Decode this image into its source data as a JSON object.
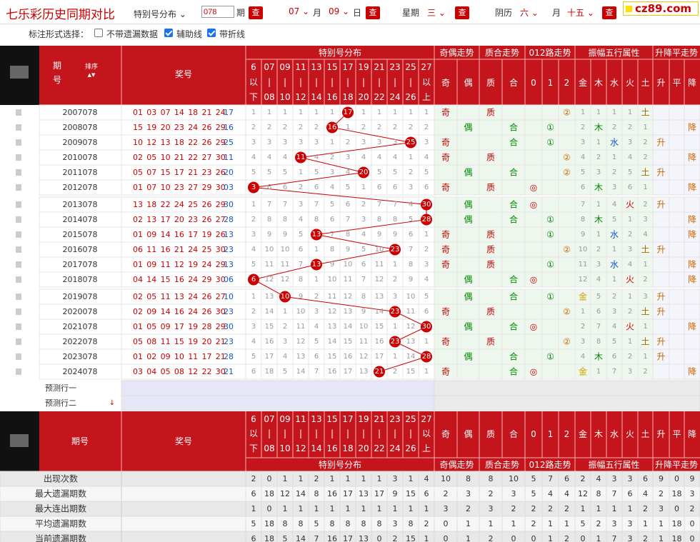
{
  "header": {
    "title": "七乐彩历史同期对比",
    "dist_select": "特别号分布",
    "period_input": "078",
    "period_label": "期",
    "query_label": "查",
    "month_value": "07",
    "month_label": "月",
    "day_value": "09",
    "day_label": "日",
    "weekday_label": "星期",
    "weekday_value": "三",
    "lunar_label": "阴历",
    "lunar_month_value": "六",
    "lunar_month_label": "月",
    "lunar_day_value": "十五",
    "logo": "cz89.com"
  },
  "options": {
    "label": "标注形式选择：",
    "opt1": "不带遗漏数据",
    "opt2": "辅助线",
    "opt3": "带折线",
    "opt1_checked": false,
    "opt2_checked": true,
    "opt3_checked": true
  },
  "table": {
    "head": {
      "period": "期号",
      "sort": "排序",
      "numbers": "奖号",
      "dist_group": "特别号分布",
      "parity_group": "奇偶走势",
      "prime_group": "质合走势",
      "r012_group": "012路走势",
      "wuxing_group": "振幅五行属性",
      "trend_group": "升降平走势",
      "dist_cols": [
        [
          "6",
          "以",
          "下"
        ],
        [
          "07",
          "|",
          "08"
        ],
        [
          "09",
          "|",
          "10"
        ],
        [
          "11",
          "|",
          "12"
        ],
        [
          "13",
          "|",
          "14"
        ],
        [
          "15",
          "|",
          "16"
        ],
        [
          "17",
          "|",
          "18"
        ],
        [
          "19",
          "|",
          "20"
        ],
        [
          "21",
          "|",
          "22"
        ],
        [
          "23",
          "|",
          "24"
        ],
        [
          "25",
          "|",
          "26"
        ],
        [
          "27",
          "以",
          "上"
        ]
      ],
      "sub_cols": [
        "奇",
        "偶",
        "质",
        "合",
        "0",
        "1",
        "2",
        "金",
        "木",
        "水",
        "火",
        "土",
        "升",
        "平",
        "降"
      ]
    },
    "rows": [
      {
        "period": "2007078",
        "nums": [
          "01",
          "03",
          "07",
          "14",
          "18",
          "21",
          "24"
        ],
        "special": "17",
        "dist": [
          "1",
          "1",
          "1",
          "1",
          "1",
          "1",
          "17",
          "1",
          "1",
          "1",
          "1",
          "1"
        ],
        "hit": 6,
        "sub": [
          "奇",
          "",
          "质",
          "",
          "",
          "",
          "②",
          "1",
          "1",
          "1",
          "1",
          "土",
          "",
          "",
          ""
        ]
      },
      {
        "period": "2008078",
        "nums": [
          "15",
          "19",
          "20",
          "23",
          "24",
          "26",
          "29"
        ],
        "special": "16",
        "dist": [
          "2",
          "2",
          "2",
          "2",
          "2",
          "16",
          "1",
          "2",
          "2",
          "2",
          "2",
          "2"
        ],
        "hit": 5,
        "sub": [
          "",
          "偶",
          "",
          "合",
          "",
          "①",
          "",
          "2",
          "木",
          "2",
          "2",
          "1",
          "",
          "",
          "降"
        ]
      },
      {
        "period": "2009078",
        "nums": [
          "10",
          "12",
          "13",
          "18",
          "22",
          "26",
          "29"
        ],
        "special": "25",
        "dist": [
          "3",
          "3",
          "3",
          "3",
          "3",
          "1",
          "2",
          "3",
          "3",
          "3",
          "25",
          "3"
        ],
        "hit": 10,
        "sub": [
          "奇",
          "",
          "",
          "合",
          "",
          "①",
          "",
          "3",
          "1",
          "水",
          "3",
          "2",
          "升",
          "",
          ""
        ]
      },
      {
        "period": "2010078",
        "nums": [
          "02",
          "05",
          "10",
          "21",
          "22",
          "27",
          "30"
        ],
        "special": "11",
        "dist": [
          "4",
          "4",
          "4",
          "11",
          "4",
          "2",
          "3",
          "4",
          "4",
          "4",
          "1",
          "4"
        ],
        "hit": 3,
        "sub": [
          "奇",
          "",
          "质",
          "",
          "",
          "",
          "②",
          "4",
          "2",
          "1",
          "4",
          "2",
          "",
          "",
          "降"
        ]
      },
      {
        "period": "2011078",
        "nums": [
          "05",
          "07",
          "15",
          "17",
          "21",
          "23",
          "26"
        ],
        "special": "20",
        "dist": [
          "5",
          "5",
          "5",
          "1",
          "5",
          "3",
          "4",
          "20",
          "5",
          "5",
          "2",
          "5"
        ],
        "hit": 7,
        "sub": [
          "",
          "偶",
          "",
          "合",
          "",
          "",
          "②",
          "5",
          "3",
          "2",
          "5",
          "土",
          "升",
          "",
          ""
        ]
      },
      {
        "period": "2012078",
        "nums": [
          "01",
          "07",
          "10",
          "23",
          "27",
          "29",
          "30"
        ],
        "special": "03",
        "dist": [
          "3",
          "6",
          "6",
          "2",
          "6",
          "4",
          "5",
          "1",
          "6",
          "6",
          "3",
          "6"
        ],
        "hit": 0,
        "sub": [
          "奇",
          "",
          "质",
          "",
          "◎",
          "",
          "",
          "6",
          "木",
          "3",
          "6",
          "1",
          "",
          "",
          "降"
        ]
      },
      {
        "period": "2013078",
        "nums": [
          "13",
          "18",
          "22",
          "24",
          "25",
          "26",
          "29"
        ],
        "special": "30",
        "dist": [
          "1",
          "7",
          "7",
          "3",
          "7",
          "5",
          "6",
          "2",
          "7",
          "7",
          "4",
          "30"
        ],
        "hit": 11,
        "sub": [
          "",
          "偶",
          "",
          "合",
          "◎",
          "",
          "",
          "7",
          "1",
          "4",
          "火",
          "2",
          "升",
          "",
          ""
        ]
      },
      {
        "period": "2014078",
        "nums": [
          "02",
          "13",
          "17",
          "20",
          "23",
          "26",
          "27"
        ],
        "special": "28",
        "dist": [
          "2",
          "8",
          "8",
          "4",
          "8",
          "6",
          "7",
          "3",
          "8",
          "8",
          "5",
          "28"
        ],
        "hit": 11,
        "sub": [
          "",
          "偶",
          "",
          "合",
          "",
          "①",
          "",
          "8",
          "木",
          "5",
          "1",
          "3",
          "",
          "",
          "降"
        ]
      },
      {
        "period": "2015078",
        "nums": [
          "01",
          "09",
          "14",
          "16",
          "17",
          "19",
          "26"
        ],
        "special": "13",
        "dist": [
          "3",
          "9",
          "9",
          "5",
          "13",
          "7",
          "8",
          "4",
          "9",
          "9",
          "6",
          "1"
        ],
        "hit": 4,
        "sub": [
          "奇",
          "",
          "质",
          "",
          "",
          "①",
          "",
          "9",
          "1",
          "水",
          "2",
          "4",
          "",
          "",
          "降"
        ]
      },
      {
        "period": "2016078",
        "nums": [
          "06",
          "11",
          "16",
          "21",
          "24",
          "25",
          "30"
        ],
        "special": "23",
        "dist": [
          "4",
          "10",
          "10",
          "6",
          "1",
          "8",
          "9",
          "5",
          "10",
          "23",
          "7",
          "2"
        ],
        "hit": 9,
        "sub": [
          "奇",
          "",
          "质",
          "",
          "",
          "",
          "②",
          "10",
          "2",
          "1",
          "3",
          "土",
          "升",
          "",
          ""
        ]
      },
      {
        "period": "2017078",
        "nums": [
          "01",
          "09",
          "11",
          "12",
          "19",
          "24",
          "29"
        ],
        "special": "13",
        "dist": [
          "5",
          "11",
          "11",
          "7",
          "13",
          "9",
          "10",
          "6",
          "11",
          "1",
          "8",
          "3"
        ],
        "hit": 4,
        "sub": [
          "奇",
          "",
          "质",
          "",
          "",
          "①",
          "",
          "11",
          "3",
          "水",
          "4",
          "1",
          "",
          "",
          "降"
        ]
      },
      {
        "period": "2018078",
        "nums": [
          "04",
          "14",
          "15",
          "16",
          "24",
          "29",
          "30"
        ],
        "special": "06",
        "dist": [
          "6",
          "12",
          "12",
          "8",
          "1",
          "10",
          "11",
          "7",
          "12",
          "2",
          "9",
          "4"
        ],
        "hit": 0,
        "sub": [
          "",
          "偶",
          "",
          "合",
          "◎",
          "",
          "",
          "12",
          "4",
          "1",
          "火",
          "2",
          "",
          "",
          "降"
        ]
      },
      {
        "period": "2019078",
        "nums": [
          "02",
          "05",
          "11",
          "13",
          "24",
          "26",
          "27"
        ],
        "special": "10",
        "dist": [
          "1",
          "13",
          "10",
          "9",
          "2",
          "11",
          "12",
          "8",
          "13",
          "3",
          "10",
          "5"
        ],
        "hit": 2,
        "sub": [
          "",
          "偶",
          "",
          "合",
          "",
          "①",
          "",
          "金",
          "5",
          "2",
          "1",
          "3",
          "升",
          "",
          ""
        ]
      },
      {
        "period": "2020078",
        "nums": [
          "02",
          "09",
          "14",
          "16",
          "24",
          "26",
          "30"
        ],
        "special": "23",
        "dist": [
          "2",
          "14",
          "1",
          "10",
          "3",
          "12",
          "13",
          "9",
          "14",
          "23",
          "11",
          "6"
        ],
        "hit": 9,
        "sub": [
          "奇",
          "",
          "质",
          "",
          "",
          "",
          "②",
          "1",
          "6",
          "3",
          "2",
          "土",
          "升",
          "",
          ""
        ]
      },
      {
        "period": "2021078",
        "nums": [
          "01",
          "05",
          "09",
          "17",
          "19",
          "28",
          "29"
        ],
        "special": "30",
        "dist": [
          "3",
          "15",
          "2",
          "11",
          "4",
          "13",
          "14",
          "10",
          "15",
          "1",
          "12",
          "30"
        ],
        "hit": 11,
        "sub": [
          "",
          "偶",
          "",
          "合",
          "◎",
          "",
          "",
          "2",
          "7",
          "4",
          "火",
          "1",
          "",
          "",
          "降"
        ]
      },
      {
        "period": "2022078",
        "nums": [
          "05",
          "08",
          "11",
          "15",
          "19",
          "20",
          "21"
        ],
        "special": "23",
        "dist": [
          "4",
          "16",
          "3",
          "12",
          "5",
          "14",
          "15",
          "11",
          "16",
          "23",
          "13",
          "1"
        ],
        "hit": 9,
        "sub": [
          "奇",
          "",
          "质",
          "",
          "",
          "",
          "②",
          "3",
          "8",
          "5",
          "1",
          "土",
          "升",
          "",
          ""
        ]
      },
      {
        "period": "2023078",
        "nums": [
          "01",
          "02",
          "09",
          "10",
          "11",
          "17",
          "21"
        ],
        "special": "28",
        "dist": [
          "5",
          "17",
          "4",
          "13",
          "6",
          "15",
          "16",
          "12",
          "17",
          "1",
          "14",
          "28"
        ],
        "hit": 11,
        "sub": [
          "",
          "偶",
          "",
          "合",
          "",
          "①",
          "",
          "4",
          "木",
          "6",
          "2",
          "1",
          "升",
          "",
          ""
        ]
      },
      {
        "period": "2024078",
        "nums": [
          "03",
          "04",
          "05",
          "08",
          "12",
          "22",
          "30"
        ],
        "special": "21",
        "dist": [
          "6",
          "18",
          "5",
          "14",
          "7",
          "16",
          "17",
          "13",
          "21",
          "2",
          "15",
          "1"
        ],
        "hit": 8,
        "sub": [
          "奇",
          "",
          "",
          "合",
          "◎",
          "",
          "",
          "金",
          "1",
          "7",
          "3",
          "2",
          "",
          "",
          "降"
        ]
      }
    ],
    "predict": [
      "预测行一",
      "预测行二"
    ],
    "stats": [
      {
        "label": "出现次数",
        "vals": [
          "2",
          "0",
          "1",
          "1",
          "2",
          "1",
          "1",
          "1",
          "1",
          "3",
          "1",
          "4",
          "10",
          "8",
          "8",
          "10",
          "5",
          "7",
          "6",
          "2",
          "4",
          "3",
          "3",
          "6",
          "9",
          "0",
          "9"
        ]
      },
      {
        "label": "最大遗漏期数",
        "vals": [
          "6",
          "18",
          "12",
          "14",
          "8",
          "16",
          "17",
          "13",
          "17",
          "9",
          "15",
          "6",
          "2",
          "3",
          "2",
          "3",
          "5",
          "4",
          "4",
          "12",
          "8",
          "7",
          "6",
          "4",
          "2",
          "18",
          "3"
        ]
      },
      {
        "label": "最大连出期数",
        "vals": [
          "1",
          "0",
          "1",
          "1",
          "1",
          "1",
          "1",
          "1",
          "1",
          "1",
          "1",
          "1",
          "3",
          "2",
          "3",
          "2",
          "2",
          "2",
          "2",
          "1",
          "1",
          "1",
          "1",
          "2",
          "3",
          "0",
          "2"
        ]
      },
      {
        "label": "平均遗漏期数",
        "vals": [
          "5",
          "18",
          "8",
          "8",
          "5",
          "8",
          "8",
          "8",
          "8",
          "3",
          "8",
          "2",
          "0",
          "1",
          "1",
          "1",
          "2",
          "1",
          "1",
          "5",
          "2",
          "3",
          "3",
          "1",
          "1",
          "18",
          "0"
        ]
      },
      {
        "label": "当前遗漏期数",
        "vals": [
          "6",
          "18",
          "5",
          "14",
          "7",
          "16",
          "17",
          "13",
          "0",
          "2",
          "15",
          "1",
          "0",
          "1",
          "2",
          "0",
          "0",
          "1",
          "2",
          "0",
          "1",
          "7",
          "3",
          "2",
          "1",
          "18",
          "0"
        ]
      }
    ]
  }
}
